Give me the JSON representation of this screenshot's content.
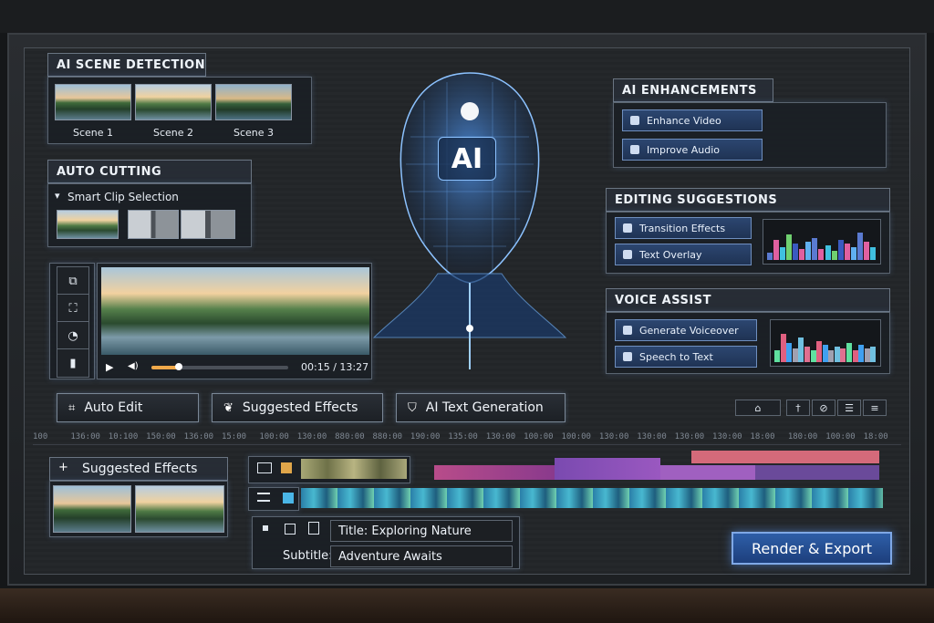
{
  "scene_detection": {
    "title": "AI SCENE DETECTION",
    "scenes": [
      "Scene 1",
      "Scene 2",
      "Scene 3"
    ]
  },
  "auto_cutting": {
    "title": "AUTO CUTTING",
    "option": "Smart Clip Selection",
    "chevron_glyph": "▾"
  },
  "preview": {
    "time": "00:15 / 13:27",
    "progress": 0.2,
    "play_glyph": "▶",
    "volume_glyph": "◀)",
    "side_icons": [
      "⧉",
      "⛶",
      "◔",
      "▮"
    ]
  },
  "ai_center": {
    "label": "AI"
  },
  "enhancements": {
    "title": "AI ENHANCEMENTS",
    "buttons": [
      "Enhance Video",
      "Improve Audio"
    ]
  },
  "editing_suggestions": {
    "title": "EDITING SUGGESTIONS",
    "buttons": [
      "Transition Effects",
      "Text Overlay"
    ],
    "levels": [
      0.2,
      0.55,
      0.35,
      0.7,
      0.45,
      0.3,
      0.5,
      0.6,
      0.3,
      0.4,
      0.25,
      0.55,
      0.45,
      0.35,
      0.75,
      0.5,
      0.35
    ]
  },
  "voice_assist": {
    "title": "VOICE ASSIST",
    "buttons": [
      "Generate Voiceover",
      "Speech to Text"
    ],
    "levels": [
      0.3,
      0.75,
      0.5,
      0.35,
      0.65,
      0.4,
      0.3,
      0.55,
      0.45,
      0.3,
      0.4,
      0.35,
      0.5,
      0.3,
      0.45,
      0.35,
      0.4
    ]
  },
  "toolbar": {
    "auto_edit": "Auto Edit",
    "suggested_effects": "Suggested Effects",
    "ai_text": "AI Text Generation",
    "auto_edit_icon": "⌗",
    "suggested_effects_icon": "❦",
    "ai_text_icon": "⛉",
    "right_icons": [
      "⌂",
      "†",
      "⊘",
      "☰",
      "≡"
    ]
  },
  "timeline": {
    "ruler_labels": [
      "100",
      "136:00",
      "10:100",
      "150:00",
      "136:00",
      "15:00",
      "100:00",
      "130:00",
      "880:00",
      "880:00",
      "190:00",
      "135:00",
      "130:00",
      "100:00",
      "100:00",
      "130:00",
      "130:00",
      "130:00",
      "130:00",
      "18:00",
      "180:00",
      "100:00",
      "18:00"
    ]
  },
  "effects_panel": {
    "title": "Suggested Effects",
    "plus": "+"
  },
  "text_fields": {
    "title_label": "Title:",
    "title_value": "Exploring Nature",
    "subtitle_label": "Subtitle:",
    "subtitle_value": "Adventure Awaits"
  },
  "render_button": "Render & Export",
  "colors": {
    "accent": "#2e5ea8",
    "panel_border": "#5a6470",
    "glow": "#5aa0ff"
  }
}
